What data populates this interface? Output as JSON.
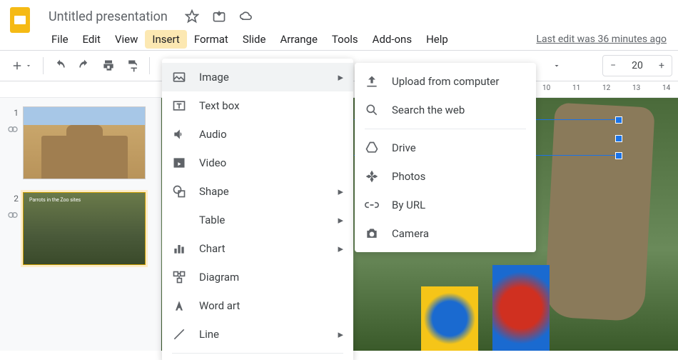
{
  "doc": {
    "title": "Untitled presentation",
    "last_edit": "Last edit was 36 minutes ago"
  },
  "menubar": {
    "items": [
      "File",
      "Edit",
      "View",
      "Insert",
      "Format",
      "Slide",
      "Arrange",
      "Tools",
      "Add-ons",
      "Help"
    ],
    "active_index": 3
  },
  "zoom": {
    "value": "20"
  },
  "ruler": {
    "ticks": [
      "10",
      "11",
      "12",
      "13",
      "14"
    ]
  },
  "slides": [
    {
      "num": "1"
    },
    {
      "num": "2",
      "caption": "Parrots in the Zoo sites"
    }
  ],
  "insert_menu": [
    {
      "label": "Image",
      "icon": "image-icon",
      "submenu": true,
      "hover": true
    },
    {
      "label": "Text box",
      "icon": "textbox-icon",
      "submenu": false
    },
    {
      "label": "Audio",
      "icon": "audio-icon",
      "submenu": false
    },
    {
      "label": "Video",
      "icon": "video-icon",
      "submenu": false
    },
    {
      "label": "Shape",
      "icon": "shape-icon",
      "submenu": true
    },
    {
      "label": "Table",
      "icon": "",
      "submenu": true
    },
    {
      "label": "Chart",
      "icon": "chart-icon",
      "submenu": true
    },
    {
      "label": "Diagram",
      "icon": "diagram-icon",
      "submenu": false
    },
    {
      "label": "Word art",
      "icon": "wordart-icon",
      "submenu": false
    },
    {
      "label": "Line",
      "icon": "line-icon",
      "submenu": true
    }
  ],
  "image_menu": [
    {
      "label": "Upload from computer",
      "icon": "upload-icon"
    },
    {
      "label": "Search the web",
      "icon": "search-icon"
    },
    {
      "sep": true
    },
    {
      "label": "Drive",
      "icon": "drive-icon"
    },
    {
      "label": "Photos",
      "icon": "photos-icon"
    },
    {
      "label": "By URL",
      "icon": "link-icon"
    },
    {
      "label": "Camera",
      "icon": "camera-icon"
    }
  ]
}
